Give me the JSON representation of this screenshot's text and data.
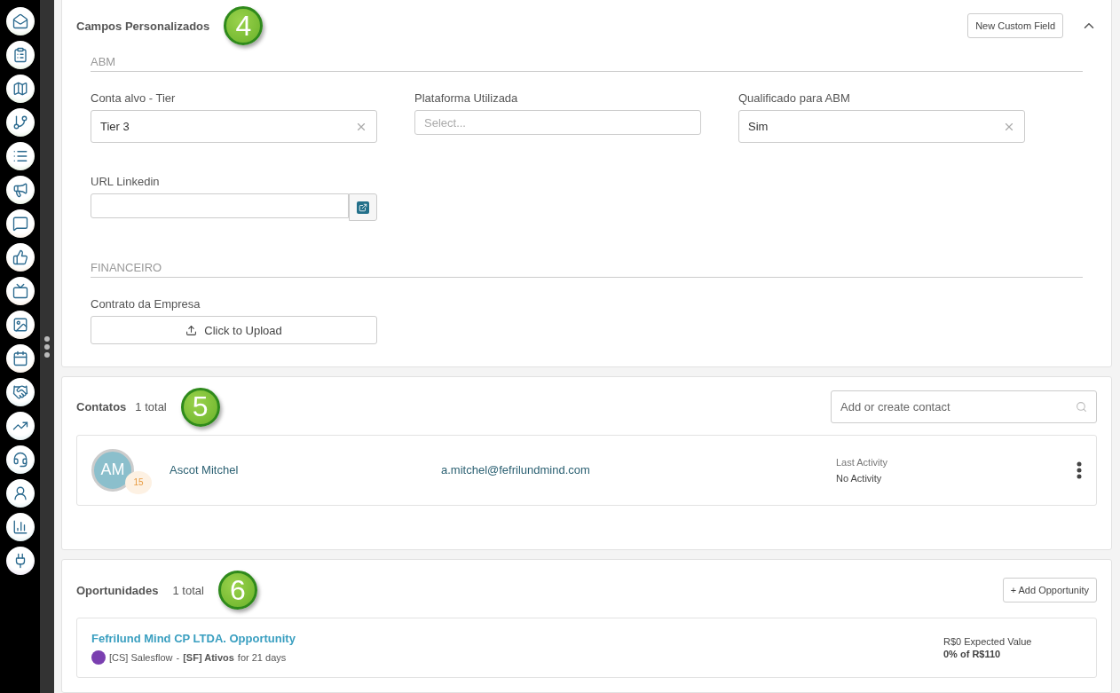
{
  "custom_fields": {
    "title": "Campos Personalizados",
    "step_badge": "4",
    "new_button": "New Custom Field",
    "expanded": true,
    "sections": [
      {
        "heading": "ABM",
        "fields": [
          {
            "kind": "select",
            "label": "Conta alvo - Tier",
            "value": "Tier 3"
          },
          {
            "kind": "select",
            "label": "Plataforma Utilizada",
            "placeholder": "Select..."
          },
          {
            "kind": "select",
            "label": "Qualificado para ABM",
            "value": "Sim"
          },
          {
            "kind": "url",
            "label": "URL Linkedin"
          }
        ]
      },
      {
        "heading": "FINANCEIRO",
        "fields": [
          {
            "kind": "upload",
            "label": "Contrato da Empresa",
            "button": "Click to Upload"
          }
        ]
      }
    ]
  },
  "contacts": {
    "title": "Contatos",
    "count": "1 total",
    "step_badge": "5",
    "search": {
      "placeholder": "Add or create contact"
    },
    "items": [
      {
        "initials": "AM",
        "score": "15",
        "name": "Ascot Mitchel",
        "email": "a.mitchel@fefrilundmind.com",
        "activity_label": "Last Activity",
        "activity": "No Activity"
      }
    ]
  },
  "opportunities": {
    "title": "Oportunidades",
    "count": "1 total",
    "step_badge": "6",
    "add_button": "+ Add Opportunity",
    "items": [
      {
        "title": "Fefrilund Mind CP LTDA. Opportunity",
        "pipeline": "[CS] Salesflow",
        "separator": "-",
        "stage": "[SF] Ativos",
        "duration": "for 21 days",
        "expected": "R$0 Expected Value",
        "progress": "0% of R$110"
      }
    ]
  }
}
